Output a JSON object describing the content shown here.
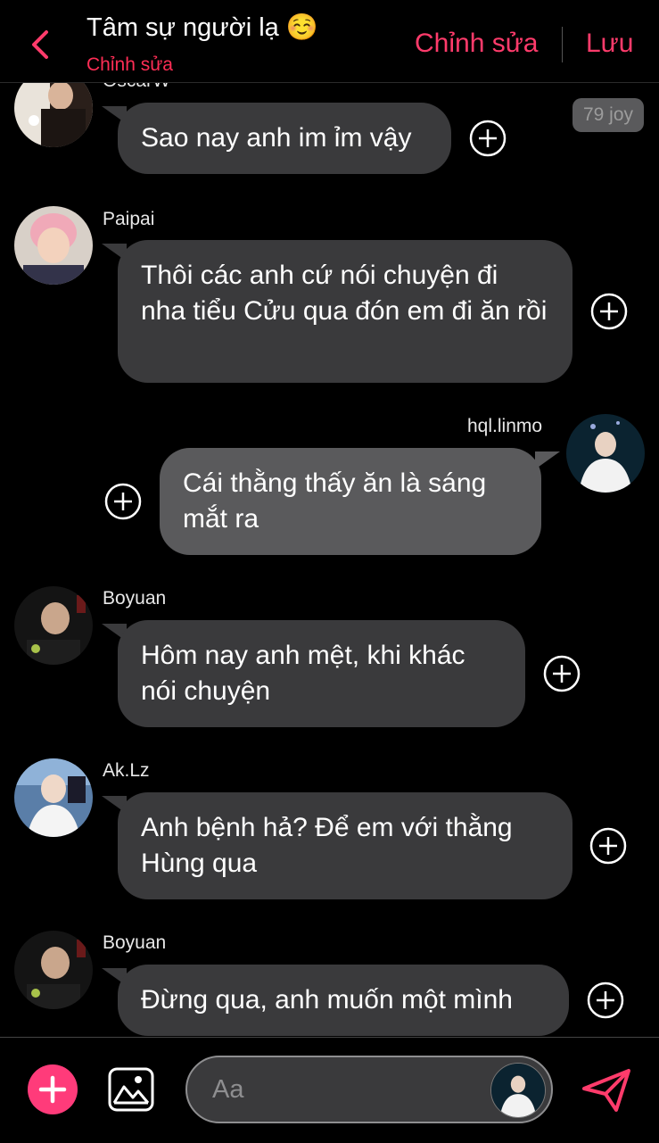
{
  "header": {
    "title": "Tâm sự người lạ ☺️",
    "subtitle": "Chỉnh sửa",
    "edit_label": "Chỉnh sửa",
    "save_label": "Lưu"
  },
  "messages": [
    {
      "sender": "OscarW",
      "text": "Sao nay anh im ỉm vậy",
      "side": "left"
    },
    {
      "sender": "Paipai",
      "text": "Thôi các anh cứ nói chuyện đi nha tiểu Cửu qua đón em đi ăn rồi",
      "side": "left"
    },
    {
      "sender": "hql.linmo",
      "text": "Cái thằng thấy ăn là sáng mắt ra",
      "side": "right"
    },
    {
      "sender": "Boyuan",
      "text": "Hôm nay anh mệt, khi khác nói chuyện",
      "side": "left"
    },
    {
      "sender": "Ak.Lz",
      "text": "Anh bệnh hả? Để em với thằng Hùng qua",
      "side": "left"
    },
    {
      "sender": "Boyuan",
      "text": "Đừng qua, anh muốn một mình",
      "side": "left"
    }
  ],
  "joy_badge": "79 joy",
  "composer": {
    "placeholder": "Aa"
  },
  "colors": {
    "accent": "#ff3b6b",
    "bubble": "#3a3a3c",
    "bubble_mine": "#5a5a5c",
    "background": "#000000"
  },
  "icons": [
    "back-chevron-icon",
    "plus-circle-icon",
    "add-icon",
    "image-icon",
    "send-icon"
  ]
}
